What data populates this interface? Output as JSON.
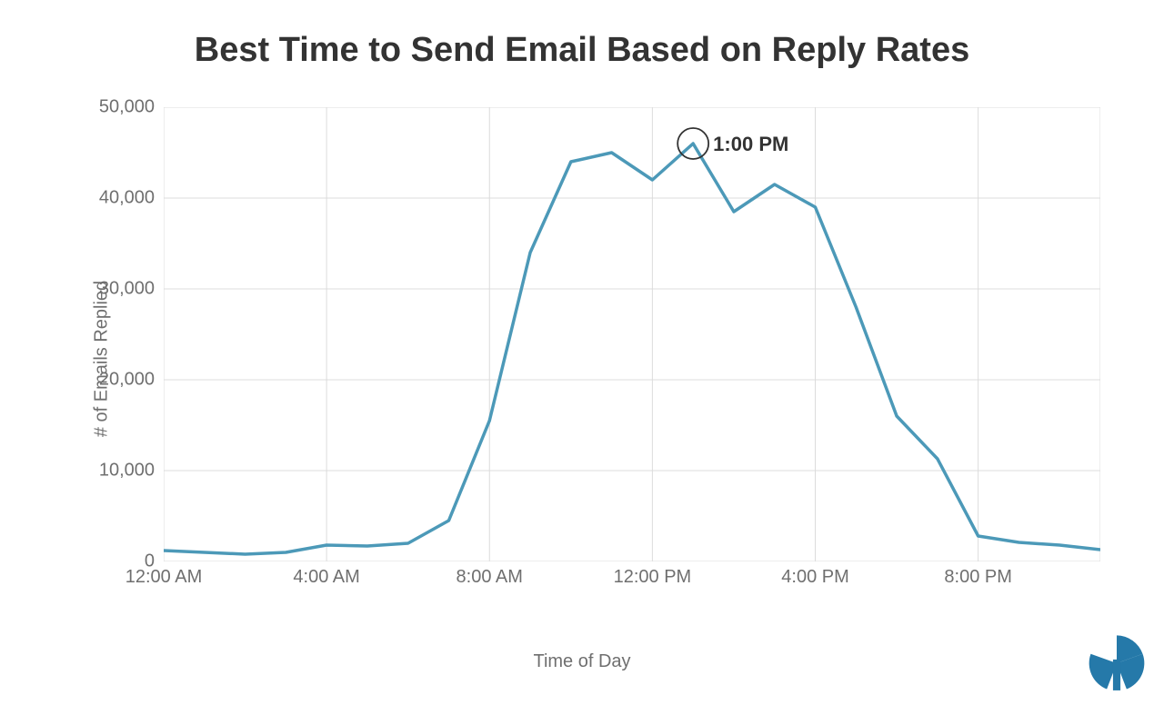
{
  "title": "Best Time to Send Email Based on Reply Rates",
  "ylabel": "# of Emails Replied",
  "xlabel": "Time of Day",
  "y_ticks": [
    "0",
    "10,000",
    "20,000",
    "30,000",
    "40,000",
    "50,000"
  ],
  "x_ticks": [
    "12:00 AM",
    "4:00 AM",
    "8:00 AM",
    "12:00 PM",
    "4:00 PM",
    "8:00 PM"
  ],
  "annotation": {
    "label": "1:00 PM"
  },
  "logo_color": "#2579a9",
  "chart_data": {
    "type": "line",
    "title": "Best Time to Send Email Based on Reply Rates",
    "xlabel": "Time of Day",
    "ylabel": "# of Emails Replied",
    "ylim": [
      0,
      50000
    ],
    "xlim": [
      0,
      23
    ],
    "grid": true,
    "legend": false,
    "line_color": "#4c99b8",
    "annotation": {
      "x": 13,
      "y": 46000,
      "label": "1:00 PM",
      "circle": true
    },
    "x_tick_values": [
      0,
      4,
      8,
      12,
      16,
      20
    ],
    "x_tick_labels": [
      "12:00 AM",
      "4:00 AM",
      "8:00 AM",
      "12:00 PM",
      "4:00 PM",
      "8:00 PM"
    ],
    "y_tick_values": [
      0,
      10000,
      20000,
      30000,
      40000,
      50000
    ],
    "series": [
      {
        "name": "Emails Replied",
        "x": [
          0,
          1,
          2,
          3,
          4,
          5,
          6,
          7,
          8,
          9,
          10,
          11,
          12,
          13,
          14,
          15,
          16,
          17,
          18,
          19,
          20,
          21,
          22,
          23
        ],
        "y": [
          1200,
          1000,
          800,
          1000,
          1800,
          1700,
          2000,
          4500,
          15500,
          34000,
          44000,
          45000,
          42000,
          46000,
          38500,
          41500,
          39000,
          28000,
          16000,
          11300,
          2800,
          2100,
          1800,
          1300
        ]
      }
    ]
  }
}
